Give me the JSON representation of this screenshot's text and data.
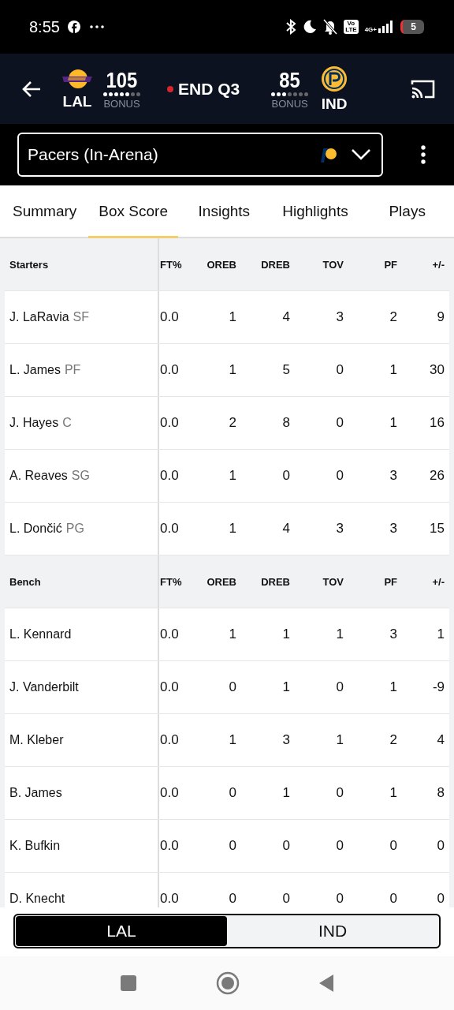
{
  "status_bar": {
    "time": "8:55",
    "volte_top": "Vo",
    "volte_bottom": "LTE",
    "network": "4G+",
    "battery": "5"
  },
  "scoreboard": {
    "away": {
      "abbr": "LAL",
      "score": "105",
      "bonus": "BONUS",
      "timeouts": [
        true,
        true,
        true,
        true,
        true,
        false,
        false
      ]
    },
    "period": "END Q3",
    "live": true,
    "home": {
      "abbr": "IND",
      "score": "85",
      "bonus": "BONUS",
      "timeouts": [
        true,
        true,
        true,
        false,
        false,
        false,
        false
      ]
    }
  },
  "audio_feed": {
    "value": "Pacers (In-Arena)"
  },
  "tabs": [
    {
      "label": "Summary",
      "selected": false
    },
    {
      "label": "Box Score",
      "selected": true
    },
    {
      "label": "Insights",
      "selected": false
    },
    {
      "label": "Highlights",
      "selected": false
    },
    {
      "label": "Plays",
      "selected": false
    }
  ],
  "sections": [
    {
      "title": "Starters",
      "columns": [
        "FT%",
        "OREB",
        "DREB",
        "TOV",
        "PF",
        "+/-"
      ],
      "rows": [
        {
          "name": "J. LaRavia",
          "position": "SF",
          "stats": [
            "0.0",
            "1",
            "4",
            "3",
            "2",
            "9"
          ]
        },
        {
          "name": "L. James",
          "position": "PF",
          "stats": [
            "0.0",
            "1",
            "5",
            "0",
            "1",
            "30"
          ]
        },
        {
          "name": "J. Hayes",
          "position": "C",
          "stats": [
            "0.0",
            "2",
            "8",
            "0",
            "1",
            "16"
          ]
        },
        {
          "name": "A. Reaves",
          "position": "SG",
          "stats": [
            "0.0",
            "1",
            "0",
            "0",
            "3",
            "26"
          ]
        },
        {
          "name": "L. Dončić",
          "position": "PG",
          "stats": [
            "0.0",
            "1",
            "4",
            "3",
            "3",
            "15"
          ]
        }
      ]
    },
    {
      "title": "Bench",
      "columns": [
        "FT%",
        "OREB",
        "DREB",
        "TOV",
        "PF",
        "+/-"
      ],
      "rows": [
        {
          "name": "L. Kennard",
          "stats": [
            "0.0",
            "1",
            "1",
            "1",
            "3",
            "1"
          ]
        },
        {
          "name": "J. Vanderbilt",
          "stats": [
            "0.0",
            "0",
            "1",
            "0",
            "1",
            "-9"
          ]
        },
        {
          "name": "M. Kleber",
          "stats": [
            "0.0",
            "1",
            "3",
            "1",
            "2",
            "4"
          ]
        },
        {
          "name": "B. James",
          "stats": [
            "0.0",
            "0",
            "1",
            "0",
            "1",
            "8"
          ]
        },
        {
          "name": "K. Bufkin",
          "stats": [
            "0.0",
            "0",
            "0",
            "0",
            "0",
            "0"
          ]
        },
        {
          "name": "D. Knecht",
          "stats": [
            "0.0",
            "0",
            "0",
            "0",
            "0",
            "0"
          ]
        }
      ]
    }
  ],
  "team_toggle": [
    {
      "label": "LAL",
      "selected": true
    },
    {
      "label": "IND",
      "selected": false
    }
  ]
}
